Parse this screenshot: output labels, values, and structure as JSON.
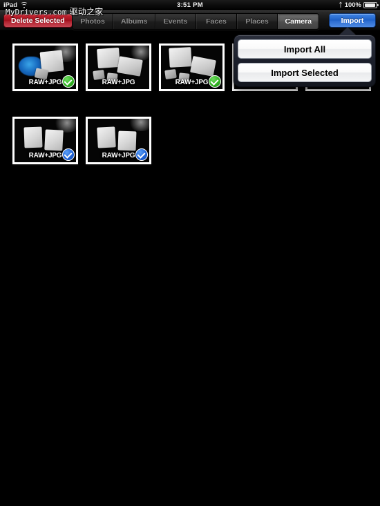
{
  "status_bar": {
    "device": "iPad",
    "wifi_icon": "wifi-icon",
    "time": "3:51 PM",
    "bluetooth_icon": "bluetooth-icon",
    "battery_percent": "100%",
    "battery_icon": "battery-icon"
  },
  "watermark": {
    "text": "MyDrivers.com",
    "cn_text": "驱动之家"
  },
  "toolbar": {
    "delete_label": "Delete Selected",
    "import_label": "Import",
    "tabs": [
      {
        "label": "Photos",
        "active": false
      },
      {
        "label": "Albums",
        "active": false
      },
      {
        "label": "Events",
        "active": false
      },
      {
        "label": "Faces",
        "active": false
      },
      {
        "label": "Places",
        "active": false
      },
      {
        "label": "Camera",
        "active": true
      }
    ]
  },
  "popover": {
    "items": [
      {
        "label": "Import All"
      },
      {
        "label": "Import Selected"
      }
    ]
  },
  "photo_grid": {
    "format_label": "RAW+JPG",
    "thumbnails": [
      {
        "label": "RAW+JPG",
        "badge": "green",
        "badge_glyph": "check"
      },
      {
        "label": "RAW+JPG",
        "badge": "none",
        "badge_glyph": ""
      },
      {
        "label": "RAW+JPG",
        "badge": "green",
        "badge_glyph": "check"
      },
      {
        "label": "RAW+JPG",
        "badge": "blue",
        "badge_glyph": "check"
      },
      {
        "label": "RAW+JPG",
        "badge": "blue",
        "badge_glyph": "check"
      }
    ]
  },
  "colors": {
    "background": "#000000",
    "toolbar": "#151515",
    "delete_red": "#9e0f1c",
    "import_blue": "#1d5fc6",
    "badge_green": "#33b324",
    "badge_blue": "#1f63d8",
    "popover_dark": "#1b1f2b",
    "popover_item": "#f4f5f6"
  }
}
